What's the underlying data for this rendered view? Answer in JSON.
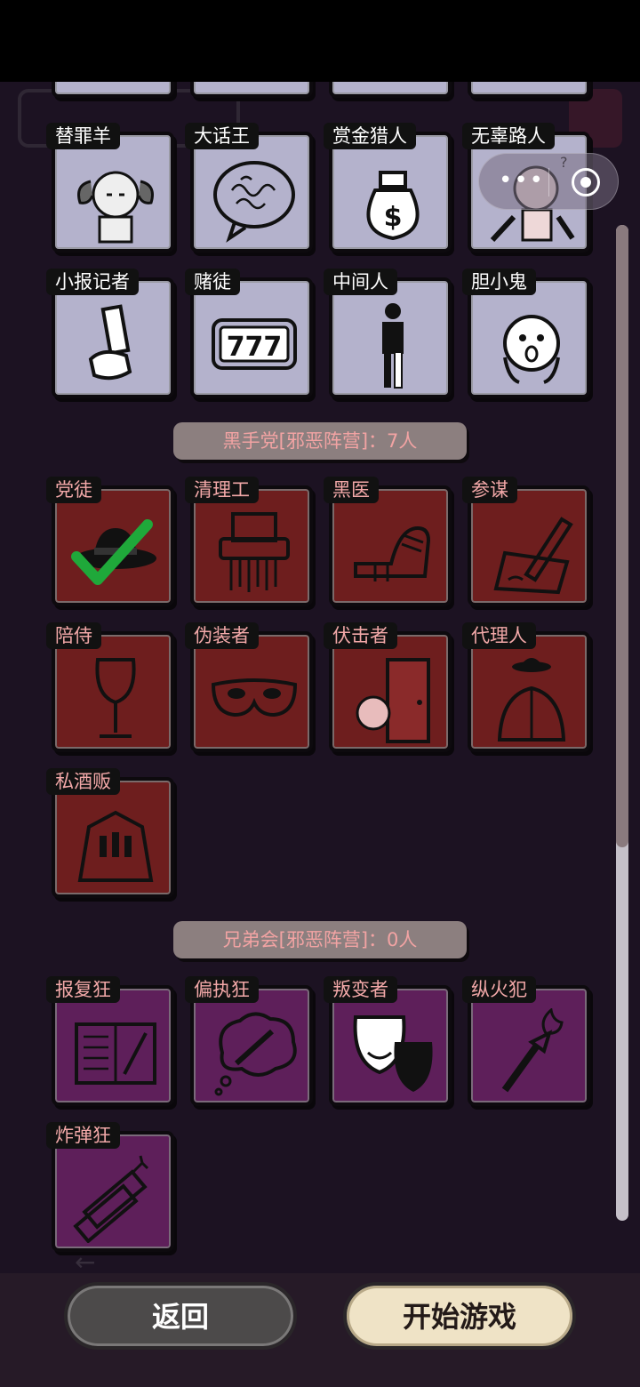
{
  "town_roles": [
    "替罪羊",
    "大话王",
    "赏金猎人",
    "无辜路人",
    "小报记者",
    "赌徒",
    "中间人",
    "胆小鬼"
  ],
  "mafia_section": {
    "title": "黑手党[邪恶阵营]：7人"
  },
  "mafia_roles": [
    "党徒",
    "清理工",
    "黑医",
    "参谋",
    "陪侍",
    "伪装者",
    "伏击者",
    "代理人",
    "私酒贩"
  ],
  "brother_section": {
    "title": "兄弟会[邪恶阵营]：0人"
  },
  "brother_roles": [
    "报复狂",
    "偏执狂",
    "叛变者",
    "纵火犯",
    "炸弹狂"
  ],
  "buttons": {
    "back": "返回",
    "start": "开始游戏"
  },
  "colors": {
    "town": "#b4b2cc",
    "mafia": "#6e1e1e",
    "brotherhood": "#5e1f5a",
    "selected_check": "#1fa83a"
  },
  "selected_role": "党徒"
}
